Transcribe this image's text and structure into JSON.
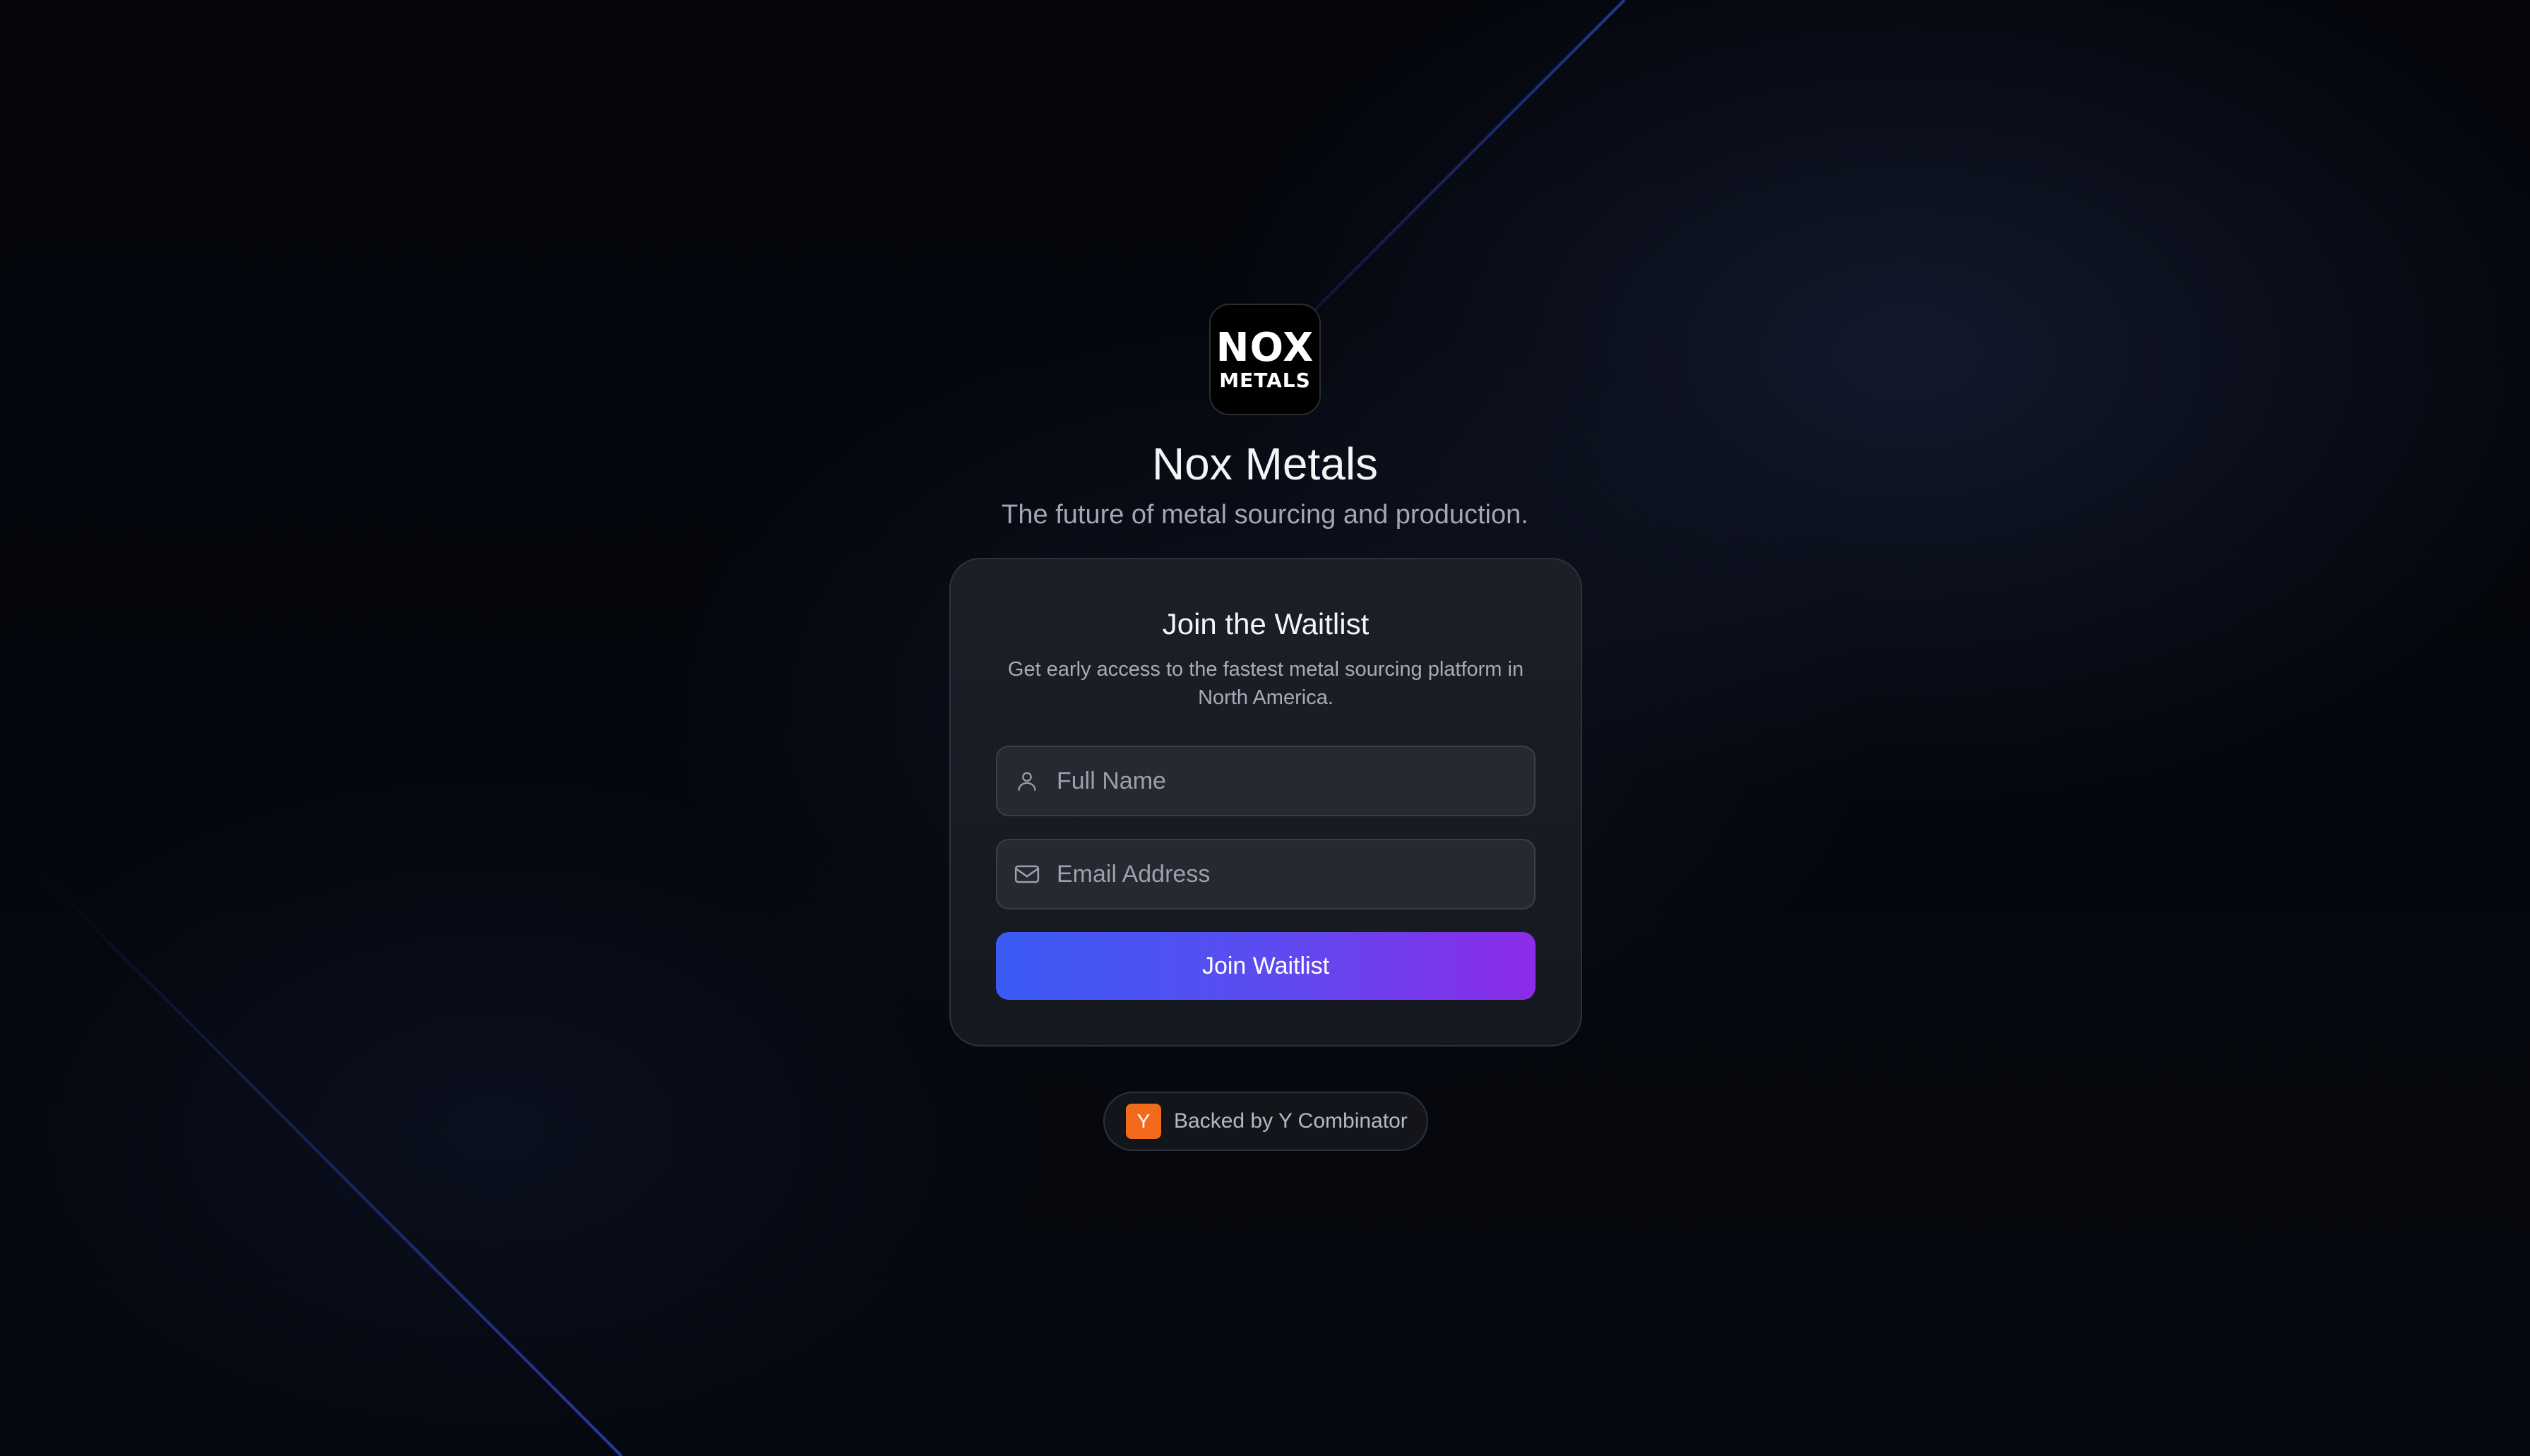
{
  "brand": {
    "logo_line1": "NOX",
    "logo_line2": "METALS",
    "title": "Nox Metals",
    "tagline": "The future of metal sourcing and production."
  },
  "waitlist_card": {
    "title": "Join the Waitlist",
    "description": "Get early access to the fastest metal sourcing platform in North America.",
    "name_field": {
      "placeholder": "Full Name",
      "value": "",
      "icon": "user-icon"
    },
    "email_field": {
      "placeholder": "Email Address",
      "value": "",
      "icon": "mail-icon"
    },
    "submit_label": "Join Waitlist"
  },
  "badge": {
    "icon_letter": "Y",
    "text": "Backed by Y Combinator"
  },
  "colors": {
    "button_gradient_start": "#3b5bf4",
    "button_gradient_end": "#8b2be8",
    "yc_orange": "#f26a1b",
    "background": "#05070d"
  }
}
